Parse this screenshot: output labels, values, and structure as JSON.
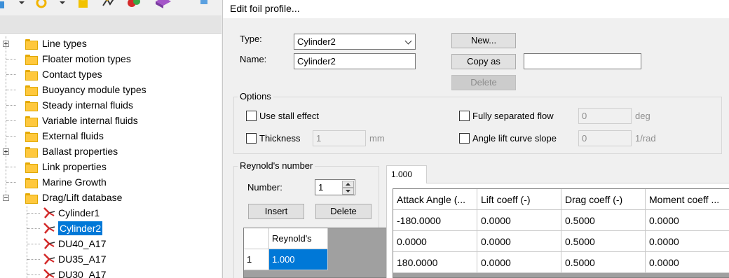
{
  "tree": {
    "items": [
      {
        "label": "Line types",
        "expandable": true
      },
      {
        "label": "Floater motion types",
        "expandable": false
      },
      {
        "label": "Contact types",
        "expandable": false
      },
      {
        "label": "Buoyancy module types",
        "expandable": false
      },
      {
        "label": "Steady internal fluids",
        "expandable": false
      },
      {
        "label": "Variable internal fluids",
        "expandable": false
      },
      {
        "label": "External fluids",
        "expandable": false
      },
      {
        "label": "Ballast properties",
        "expandable": true
      },
      {
        "label": "Link properties",
        "expandable": false
      },
      {
        "label": "Marine Growth",
        "expandable": false
      },
      {
        "label": "Drag/Lift database",
        "expandable": true,
        "expanded": true
      }
    ],
    "children": [
      {
        "label": "Cylinder1",
        "selected": false
      },
      {
        "label": "Cylinder2",
        "selected": true
      },
      {
        "label": "DU40_A17",
        "selected": false
      },
      {
        "label": "DU35_A17",
        "selected": false
      },
      {
        "label": "DU30_A17",
        "selected": false
      }
    ]
  },
  "dialog": {
    "title": "Edit foil profile...",
    "type_label": "Type:",
    "type_value": "Cylinder2",
    "name_label": "Name:",
    "name_value": "Cylinder2",
    "new_button": "New...",
    "copy_as_button": "Copy as",
    "copy_as_value": "",
    "delete_button": "Delete",
    "options": {
      "title": "Options",
      "use_stall_effect": "Use stall effect",
      "thickness_label": "Thickness",
      "thickness_value": "1",
      "thickness_unit": "mm",
      "fully_separated_flow": "Fully separated flow",
      "fully_separated_value": "0",
      "fully_separated_unit": "deg",
      "angle_lift_curve_slope": "Angle lift curve slope",
      "angle_lift_value": "0",
      "angle_lift_unit": "1/rad"
    },
    "reynolds": {
      "title": "Reynold's number",
      "number_label": "Number:",
      "number_value": "1",
      "insert_button": "Insert",
      "delete_button": "Delete",
      "column_header": "Reynold's",
      "rows": [
        {
          "index": "1",
          "value": "1.000"
        }
      ]
    },
    "tab_label": "1.000",
    "coeff_table": {
      "headers": [
        "Attack Angle (...",
        "Lift coeff (-)",
        "Drag coeff (-)",
        "Moment coeff ..."
      ],
      "rows": [
        [
          "-180.0000",
          "0.0000",
          "0.5000",
          "0.0000"
        ],
        [
          "0.0000",
          "0.0000",
          "0.5000",
          "0.0000"
        ],
        [
          "180.0000",
          "0.0000",
          "0.5000",
          "0.0000"
        ]
      ]
    }
  },
  "colors": {
    "selection": "#0078d7",
    "folder": "#ffc83d",
    "foil_icon": "#d42a2a"
  }
}
